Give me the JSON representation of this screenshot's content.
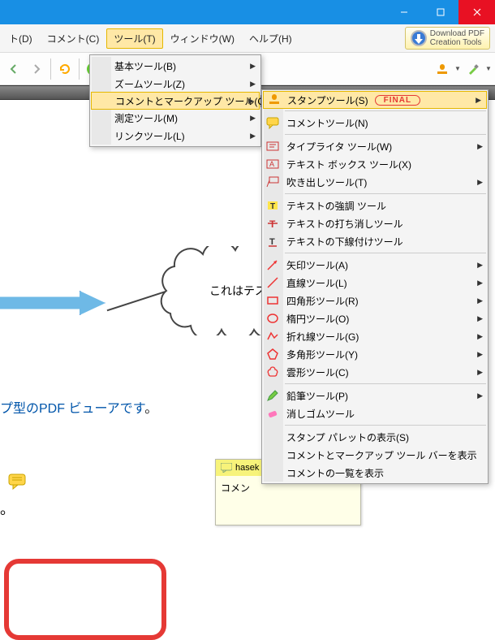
{
  "titlebar": {
    "minimize": "—",
    "maximize": "▢",
    "close": "✕"
  },
  "menubar": {
    "items": [
      "ト(D)",
      "コメント(C)",
      "ツール(T)",
      "ウィンドウ(W)",
      "ヘルプ(H)"
    ],
    "active_index": 2,
    "download_btn": "Download PDF\nCreation Tools"
  },
  "tools_menu": {
    "items": [
      {
        "label": "基本ツール(B)",
        "has_sub": true
      },
      {
        "label": "ズームツール(Z)",
        "has_sub": true
      },
      {
        "label": "コメントとマークアップ ツール(C)",
        "has_sub": true,
        "hover": true
      },
      {
        "label": "測定ツール(M)",
        "has_sub": true
      },
      {
        "label": "リンクツール(L)",
        "has_sub": true
      }
    ]
  },
  "markup_menu": {
    "groups": [
      [
        {
          "icon": "stamp",
          "label": "スタンプツール(S)",
          "badge": "FINAL",
          "has_sub": true,
          "hover": true
        }
      ],
      [
        {
          "icon": "comment",
          "label": "コメントツール(N)"
        }
      ],
      [
        {
          "icon": "typewriter",
          "label": "タイプライタ ツール(W)",
          "has_sub": true
        },
        {
          "icon": "textbox",
          "label": "テキスト ボックス ツール(X)"
        },
        {
          "icon": "callout",
          "label": "吹き出しツール(T)",
          "has_sub": true
        }
      ],
      [
        {
          "icon": "highlight",
          "label": "テキストの強調 ツール"
        },
        {
          "icon": "strikeout",
          "label": "テキストの打ち消しツール"
        },
        {
          "icon": "underline",
          "label": "テキストの下線付けツール"
        }
      ],
      [
        {
          "icon": "arrow",
          "label": "矢印ツール(A)",
          "has_sub": true
        },
        {
          "icon": "line",
          "label": "直線ツール(L)",
          "has_sub": true
        },
        {
          "icon": "rect",
          "label": "四角形ツール(R)",
          "has_sub": true
        },
        {
          "icon": "oval",
          "label": "楕円ツール(O)",
          "has_sub": true
        },
        {
          "icon": "polyline",
          "label": "折れ線ツール(G)",
          "has_sub": true
        },
        {
          "icon": "polygon",
          "label": "多角形ツール(Y)",
          "has_sub": true
        },
        {
          "icon": "cloud",
          "label": "雲形ツール(C)",
          "has_sub": true
        }
      ],
      [
        {
          "icon": "pencil",
          "label": "鉛筆ツール(P)",
          "has_sub": true
        },
        {
          "icon": "eraser",
          "label": "消しゴムツール"
        }
      ],
      [
        {
          "icon": "",
          "label": "スタンプ パレットの表示(S)"
        },
        {
          "icon": "",
          "label": "コメントとマークアップ ツール バーを表示"
        },
        {
          "icon": "",
          "label": "コメントの一覧を表示"
        }
      ]
    ]
  },
  "canvas": {
    "cloud_text": "これはテスト",
    "body_text_main": "プ型のPDF ビューアです",
    "body_text_suffix": "。",
    "note_author": "hasek",
    "note_body": "コメン",
    "dot_x": "。"
  }
}
